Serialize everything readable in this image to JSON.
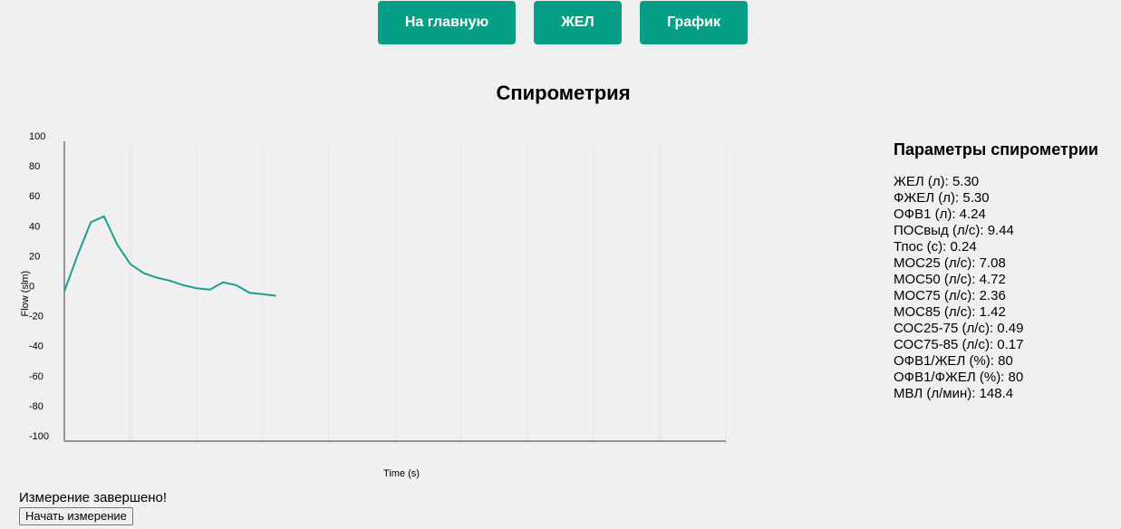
{
  "nav": {
    "home_label": "На главную",
    "vc_label": "ЖЕЛ",
    "graph_label": "График"
  },
  "page": {
    "title": "Спирометрия"
  },
  "chart_data": {
    "type": "line",
    "xlabel": "Time (s)",
    "ylabel": "Flow (slm)",
    "ylim": [
      -100,
      100
    ],
    "yticks": [
      100,
      80,
      60,
      40,
      20,
      0,
      -20,
      -40,
      -60,
      -80,
      -100
    ],
    "grid": true,
    "color": "#1aa08a",
    "series": [
      {
        "values": [
          0,
          24,
          46,
          50,
          31,
          18,
          12,
          9,
          7,
          4,
          2,
          1,
          6,
          4,
          -1,
          -2,
          -3
        ]
      }
    ]
  },
  "params": {
    "heading": "Параметры спирометрии",
    "rows": [
      "ЖЕЛ (л): 5.30",
      "ФЖЕЛ (л): 5.30",
      "ОФВ1 (л): 4.24",
      "ПОСвыд (л/с): 9.44",
      "Тпос (с): 0.24",
      "МОС25 (л/с): 7.08",
      "МОС50 (л/с): 4.72",
      "МОС75 (л/с): 2.36",
      "МОС85 (л/с): 1.42",
      "СОС25-75 (л/с): 0.49",
      "СОС75-85 (л/с): 0.17",
      "ОФВ1/ЖЕЛ (%): 80",
      "ОФВ1/ФЖЕЛ (%): 80",
      "МВЛ (л/мин): 148.4"
    ]
  },
  "status": {
    "text": "Измерение завершено!",
    "start_label": "Начать измерение"
  }
}
